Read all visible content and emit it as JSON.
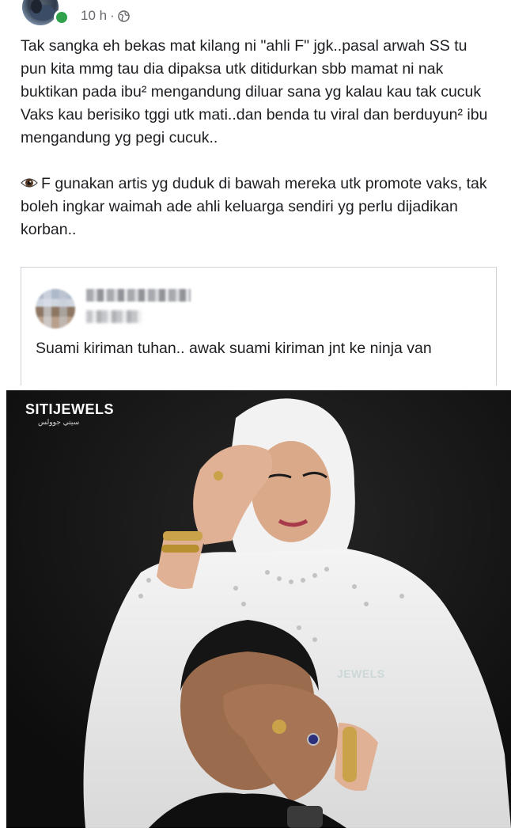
{
  "post": {
    "time": "10 h",
    "separator": "·",
    "icon": "globe-icon",
    "paragraph1": "Tak sangka eh bekas mat kilang ni \"ahli F\" jgk..pasal arwah SS tu pun kita mmg tau dia dipaksa utk ditidurkan sbb mamat ni nak buktikan pada ibu² mengandung diluar sana yg kalau kau tak cucuk Vaks kau berisiko tggi utk mati..dan benda tu viral dan berduyun² ibu mengandung yg pegi cucuk..",
    "paragraph2_emoji": "eye-emoji",
    "paragraph2": "F gunakan artis yg duduk di bawah mereka utk promote vaks, tak boleh ingkar waimah ade ahli keluarga sendiri yg perlu dijadikan korban.."
  },
  "quote": {
    "text": "Suami kiriman tuhan.. awak suami kiriman jnt ke ninja van"
  },
  "photo": {
    "brand": "SITIJEWELS",
    "brand_sub": "سيتي جوولس",
    "watermark": "JEWELS",
    "background_color": "#131313"
  },
  "colors": {
    "online": "#31a24c",
    "meta_text": "#65676b",
    "body_text": "#1c1e21"
  }
}
